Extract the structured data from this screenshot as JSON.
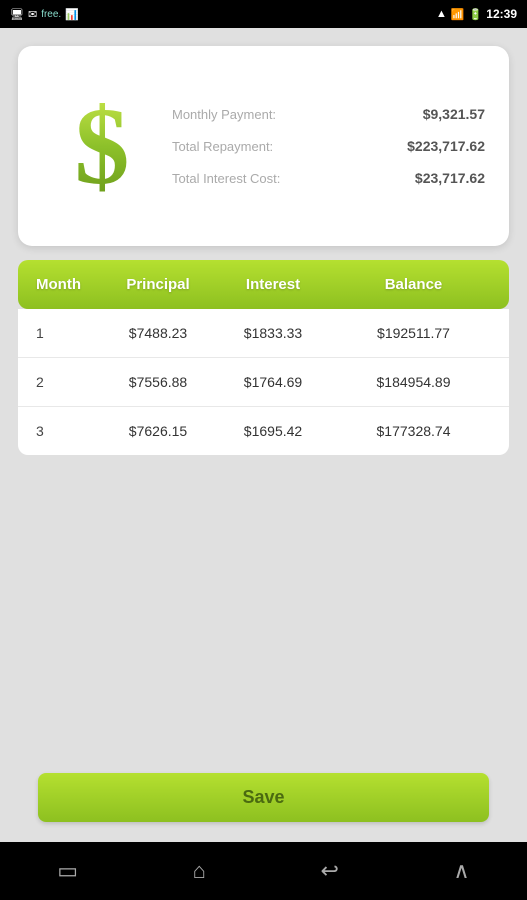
{
  "statusBar": {
    "time": "12:39",
    "icons": [
      "notification",
      "wifi",
      "signal",
      "battery"
    ]
  },
  "summaryCard": {
    "dollarSign": "$",
    "rows": [
      {
        "label": "Monthly Payment:",
        "value": "$9,321.57"
      },
      {
        "label": "Total Repayment:",
        "value": "$223,717.62"
      },
      {
        "label": "Total Interest Cost:",
        "value": "$23,717.62"
      }
    ]
  },
  "table": {
    "headers": {
      "month": "Month",
      "principal": "Principal",
      "interest": "Interest",
      "balance": "Balance"
    },
    "rows": [
      {
        "month": "1",
        "principal": "$7488.23",
        "interest": "$1833.33",
        "balance": "$192511.77"
      },
      {
        "month": "2",
        "principal": "$7556.88",
        "interest": "$1764.69",
        "balance": "$184954.89"
      },
      {
        "month": "3",
        "principal": "$7626.15",
        "interest": "$1695.42",
        "balance": "$177328.74"
      }
    ]
  },
  "saveButton": {
    "label": "Save"
  },
  "navBar": {
    "icons": [
      "recent-apps",
      "home",
      "back",
      "menu"
    ]
  }
}
